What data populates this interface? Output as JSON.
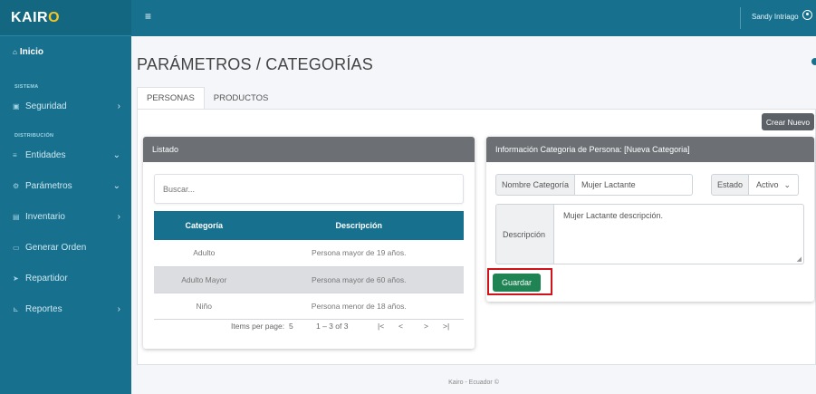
{
  "brand": {
    "prefix": "KAIR",
    "accent": "O"
  },
  "topbar": {
    "menu_glyph": "≡",
    "user": "Sandy Intriago"
  },
  "sidebar": {
    "active": "Inicio",
    "section_sistema": "SISTEMA",
    "section_distribucion": "DISTRIBUCIÓN",
    "items": [
      {
        "label": "Seguridad",
        "arrow": "›"
      },
      {
        "label": "Entidades",
        "arrow": "⌄"
      },
      {
        "label": "Parámetros",
        "arrow": "⌄"
      },
      {
        "label": "Inventario",
        "arrow": "›"
      },
      {
        "label": "Generar Orden"
      },
      {
        "label": "Repartidor"
      },
      {
        "label": "Reportes",
        "arrow": "›"
      }
    ]
  },
  "page": {
    "title": "PARÁMETROS / CATEGORÍAS"
  },
  "tabs": [
    {
      "label": "PERSONAS",
      "active": true
    },
    {
      "label": "PRODUCTOS",
      "active": false
    }
  ],
  "toolbar": {
    "new_label": "Crear Nuevo"
  },
  "listado": {
    "title": "Listado",
    "search_placeholder": "Buscar...",
    "columns": [
      "Categoría",
      "Descripción"
    ],
    "rows": [
      {
        "categoria": "Adulto",
        "descripcion": "Persona mayor de 19 años."
      },
      {
        "categoria": "Adulto Mayor",
        "descripcion": "Persona mayor de 60 años."
      },
      {
        "categoria": "Niño",
        "descripcion": "Persona menor de 18 años."
      }
    ],
    "pager": {
      "items_label": "Items per page:",
      "page_size": "5",
      "range": "1 – 3 of 3",
      "first": "|<",
      "prev": "<",
      "next": ">",
      "last": ">|"
    }
  },
  "info": {
    "title": "Información Categoria de Persona: [Nueva Categoria]",
    "nombre_label": "Nombre Categoría",
    "nombre_value": "Mujer Lactante",
    "estado_label": "Estado",
    "estado_value": "Activo",
    "descripcion_label": "Descripción",
    "descripcion_value": "Mujer Lactante descripción.",
    "save_label": "Guardar"
  },
  "footer": {
    "text": "Kairo - Ecuador ©"
  },
  "colors": {
    "sidebar": "#17718e",
    "header_gray": "#6c7075",
    "save": "#1f8354",
    "highlight": "#d0121b"
  }
}
